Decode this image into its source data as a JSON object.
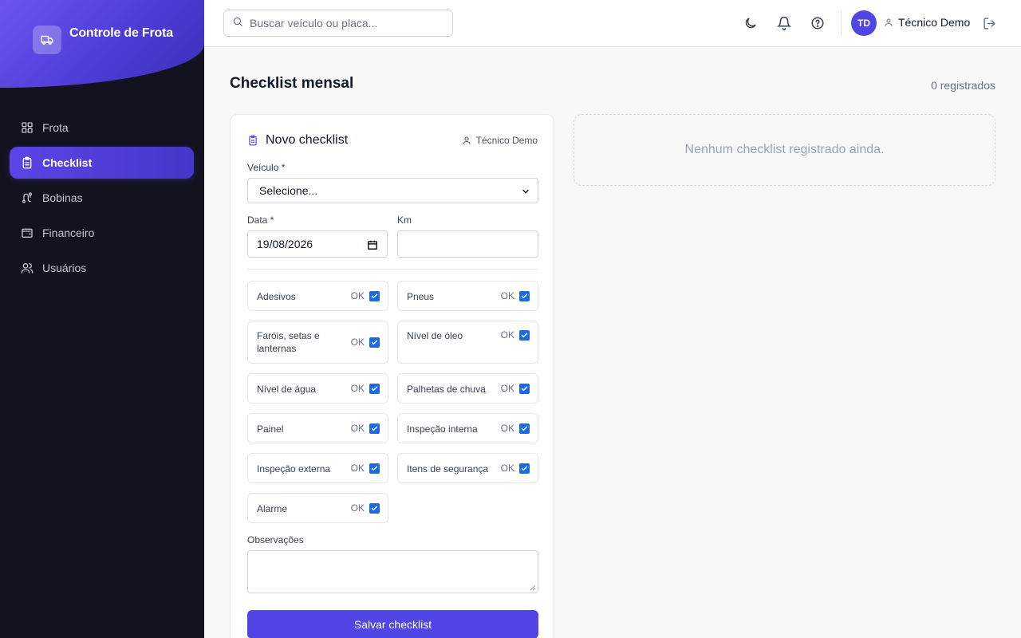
{
  "sidebar": {
    "brand": "Controle de Frota",
    "items": [
      {
        "label": "Frota",
        "icon": "grid-icon",
        "active": false
      },
      {
        "label": "Checklist",
        "icon": "clipboard-icon",
        "active": true
      },
      {
        "label": "Bobinas",
        "icon": "route-icon",
        "active": false
      },
      {
        "label": "Financeiro",
        "icon": "wallet-icon",
        "active": false
      },
      {
        "label": "Usuários",
        "icon": "users-icon",
        "active": false
      }
    ]
  },
  "topbar": {
    "search_placeholder": "Buscar veículo ou placa...",
    "avatar_initials": "TD",
    "user_name": "Técnico Demo"
  },
  "page": {
    "title": "Checklist mensal",
    "count": "0 registrados"
  },
  "form": {
    "title": "Novo checklist",
    "user": "Técnico Demo",
    "vehicle_label": "Veículo *",
    "vehicle_value": "Selecione...",
    "date_label": "Data *",
    "date_value": "19/08/2026",
    "km_label": "Km",
    "km_value": "",
    "ok_label": "OK",
    "items": [
      {
        "label": "Adesivos",
        "checked": true
      },
      {
        "label": "Pneus",
        "checked": true
      },
      {
        "label": "Faróis, setas e lanternas",
        "checked": true
      },
      {
        "label": "Nível de óleo",
        "checked": true
      },
      {
        "label": "Nível de água",
        "checked": true
      },
      {
        "label": "Palhetas de chuva",
        "checked": true
      },
      {
        "label": "Painel",
        "checked": true
      },
      {
        "label": "Inspeção interna",
        "checked": true
      },
      {
        "label": "Inspeção externa",
        "checked": true
      },
      {
        "label": "Itens de segurança",
        "checked": true
      },
      {
        "label": "Alarme",
        "checked": true
      }
    ],
    "notes_label": "Observações",
    "notes_value": "",
    "save_label": "Salvar checklist"
  },
  "empty_state": "Nenhum checklist registrado ainda.",
  "colors": {
    "accent": "#4f46e5",
    "sidebar_bg": "#12131f",
    "checkbox": "#1a6ae8"
  }
}
